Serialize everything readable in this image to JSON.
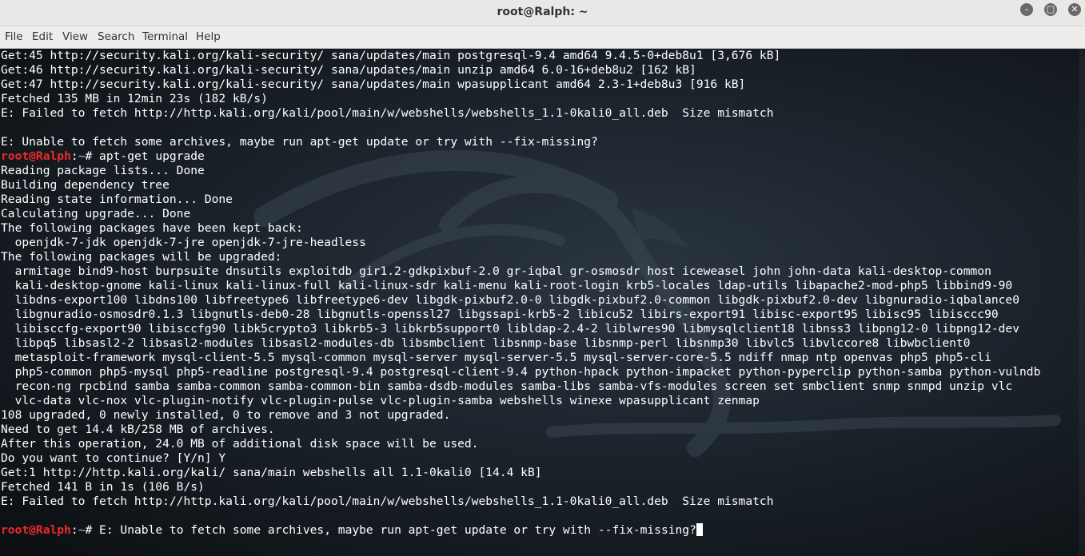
{
  "window": {
    "title": "root@Ralph: ~",
    "minimize_icon": "minimize-icon",
    "maximize_icon": "maximize-icon",
    "close_icon": "close-icon"
  },
  "menu": [
    "File",
    "Edit",
    "View",
    "Search",
    "Terminal",
    "Help"
  ],
  "prompt": {
    "user": "root@Ralph",
    "sep": ":",
    "path": "~",
    "symbol": "# "
  },
  "terminal": {
    "lines": [
      "Get:45 http://security.kali.org/kali-security/ sana/updates/main postgresql-9.4 amd64 9.4.5-0+deb8u1 [3,676 kB]",
      "Get:46 http://security.kali.org/kali-security/ sana/updates/main unzip amd64 6.0-16+deb8u2 [162 kB]",
      "Get:47 http://security.kali.org/kali-security/ sana/updates/main wpasupplicant amd64 2.3-1+deb8u3 [916 kB]",
      "Fetched 135 MB in 12min 23s (182 kB/s)",
      "E: Failed to fetch http://http.kali.org/kali/pool/main/w/webshells/webshells_1.1-0kali0_all.deb  Size mismatch",
      "",
      "E: Unable to fetch some archives, maybe run apt-get update or try with --fix-missing?",
      "apt-get upgrade",
      "Reading package lists... Done",
      "Building dependency tree",
      "Reading state information... Done",
      "Calculating upgrade... Done",
      "The following packages have been kept back:",
      "  openjdk-7-jdk openjdk-7-jre openjdk-7-jre-headless",
      "The following packages will be upgraded:",
      "  armitage bind9-host burpsuite dnsutils exploitdb gir1.2-gdkpixbuf-2.0 gr-iqbal gr-osmosdr host iceweasel john john-data kali-desktop-common",
      "  kali-desktop-gnome kali-linux kali-linux-full kali-linux-sdr kali-menu kali-root-login krb5-locales ldap-utils libapache2-mod-php5 libbind9-90",
      "  libdns-export100 libdns100 libfreetype6 libfreetype6-dev libgdk-pixbuf2.0-0 libgdk-pixbuf2.0-common libgdk-pixbuf2.0-dev libgnuradio-iqbalance0",
      "  libgnuradio-osmosdr0.1.3 libgnutls-deb0-28 libgnutls-openssl27 libgssapi-krb5-2 libicu52 libirs-export91 libisc-export95 libisc95 libisccc90",
      "  libisccfg-export90 libisccfg90 libk5crypto3 libkrb5-3 libkrb5support0 libldap-2.4-2 liblwres90 libmysqlclient18 libnss3 libpng12-0 libpng12-dev",
      "  libpq5 libsasl2-2 libsasl2-modules libsasl2-modules-db libsmbclient libsnmp-base libsnmp-perl libsnmp30 libvlc5 libvlccore8 libwbclient0",
      "  metasploit-framework mysql-client-5.5 mysql-common mysql-server mysql-server-5.5 mysql-server-core-5.5 ndiff nmap ntp openvas php5 php5-cli",
      "  php5-common php5-mysql php5-readline postgresql-9.4 postgresql-client-9.4 python-hpack python-impacket python-pyperclip python-samba python-vulndb",
      "  recon-ng rpcbind samba samba-common samba-common-bin samba-dsdb-modules samba-libs samba-vfs-modules screen set smbclient snmp snmpd unzip vlc",
      "  vlc-data vlc-nox vlc-plugin-notify vlc-plugin-pulse vlc-plugin-samba webshells winexe wpasupplicant zenmap",
      "108 upgraded, 0 newly installed, 0 to remove and 3 not upgraded.",
      "Need to get 14.4 kB/258 MB of archives.",
      "After this operation, 24.0 MB of additional disk space will be used.",
      "Do you want to continue? [Y/n] Y",
      "Get:1 http://http.kali.org/kali/ sana/main webshells all 1.1-0kali0 [14.4 kB]",
      "Fetched 141 B in 1s (106 B/s)",
      "E: Failed to fetch http://http.kali.org/kali/pool/main/w/webshells/webshells_1.1-0kali0_all.deb  Size mismatch",
      "",
      "E: Unable to fetch some archives, maybe run apt-get update or try with --fix-missing?",
      ""
    ],
    "prompt_lines": [
      7,
      33
    ],
    "cursor_line": 33
  },
  "colors": {
    "prompt_user": "#ef2929",
    "prompt_path": "#729fcf",
    "text": "#ffffff",
    "background": "#1d252e"
  }
}
